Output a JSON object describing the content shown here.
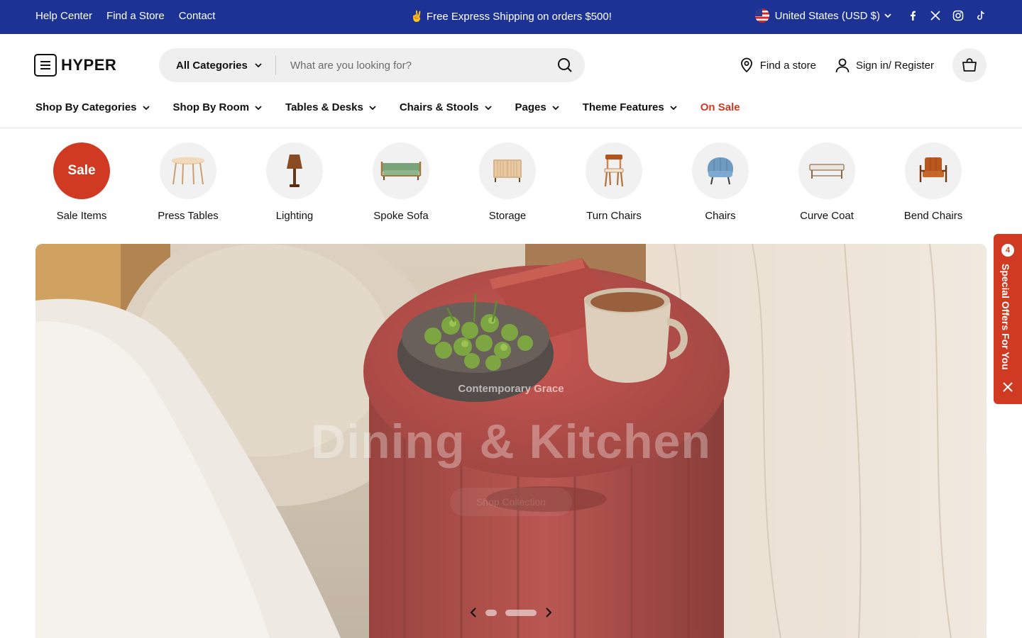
{
  "announcement": {
    "links": [
      "Help Center",
      "Find a Store",
      "Contact"
    ],
    "promo": "✌️ Free Express Shipping on orders $500!",
    "currency": "United States (USD $)",
    "socials": [
      "facebook-icon",
      "x-icon",
      "instagram-icon",
      "tiktok-icon"
    ]
  },
  "header": {
    "logo": "HYPER",
    "category_select": "All Categories",
    "search_placeholder": "What are you looking for?",
    "find_store": "Find a store",
    "account": "Sign in/ Register"
  },
  "nav": {
    "items": [
      "Shop By Categories",
      "Shop By Room",
      "Tables & Desks",
      "Chairs & Stools",
      "Pages",
      "Theme Features",
      "On Sale"
    ]
  },
  "categories": [
    {
      "label": "Sale Items",
      "badge": "Sale"
    },
    {
      "label": "Press Tables",
      "icon": "table-icon"
    },
    {
      "label": "Lighting",
      "icon": "lamp-icon"
    },
    {
      "label": "Spoke Sofa",
      "icon": "sofa-icon"
    },
    {
      "label": "Storage",
      "icon": "cabinet-icon"
    },
    {
      "label": "Turn Chairs",
      "icon": "chair-icon"
    },
    {
      "label": "Chairs",
      "icon": "armchair-icon"
    },
    {
      "label": "Curve Coat",
      "icon": "bench-icon"
    },
    {
      "label": "Bend Chairs",
      "icon": "lounge-chair-icon"
    }
  ],
  "hero": {
    "eyebrow": "Contemporary Grace",
    "headline": "Dining & Kitchen",
    "cta": "Shop Collection"
  },
  "offers": {
    "count": "4",
    "label": "Special Offers For You"
  },
  "colors": {
    "topbar": "#1c3295",
    "accent": "#d13a22",
    "search_bg": "#efefef"
  }
}
